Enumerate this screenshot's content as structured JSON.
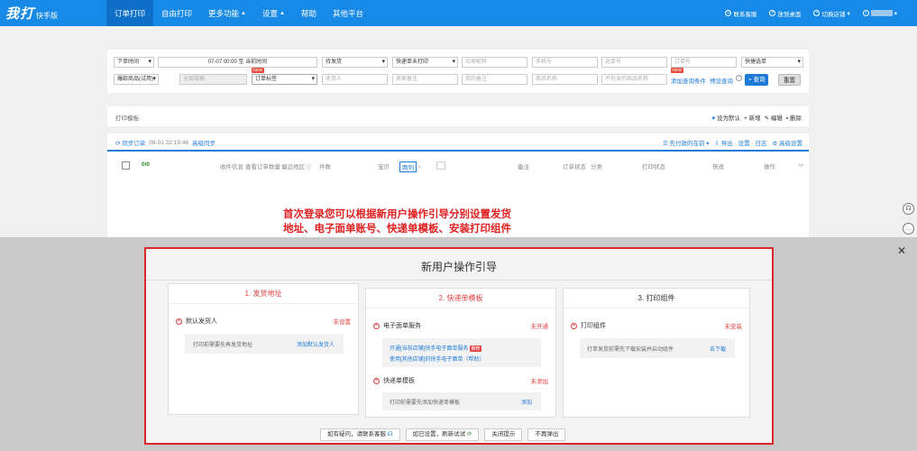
{
  "logo": {
    "main": "我打",
    "sub": "快手版"
  },
  "nav": [
    {
      "label": "订单打印",
      "active": true
    },
    {
      "label": "自由打印"
    },
    {
      "label": "更多功能",
      "caret": true
    },
    {
      "label": "设置",
      "caret": true
    },
    {
      "label": "帮助"
    },
    {
      "label": "其他平台"
    }
  ],
  "top_right": {
    "contact": "联系客服",
    "desktop": "放到桌面",
    "switch_shop": "切换店铺"
  },
  "search": {
    "order_time": "下单时间",
    "time_range": "07-07 00:00 至 当前时间",
    "status": "待发货",
    "express_print": "快递单未打印",
    "buyer_nick_ph": "买家昵称",
    "phone_ph": "手机号",
    "waybill_ph": "运单号",
    "order_no_ph": "订单号",
    "express_select": "快捷选单",
    "goods_select": "爆款商品(试用)",
    "all_spec_ph": "全部规格",
    "order_tag": "订单标签",
    "receiver_ph": "收货人",
    "seller_remark_ph": "卖家备注",
    "my_remark_ph": "我的备注",
    "goods_name_ph": "商品名称",
    "exclude_goods_ph": "不包含的商品名称",
    "add_condition": "添加查询条件",
    "preset_query": "预设查询",
    "query_btn": "查询",
    "reset_btn": "重置",
    "new_badge": "NEW"
  },
  "template": {
    "label": "打印模板:",
    "set_default": "设为默认",
    "add": "新增",
    "edit": "编辑",
    "delete": "删除"
  },
  "orders": {
    "sync": "同步订单",
    "sync_time": "09-01 22:19:46",
    "advanced_sync": "高级同步",
    "sort": "先付款的在前",
    "export": "导出 · 设置 · 日志",
    "advanced_settings": "高级设置",
    "count": "0/0",
    "headers": {
      "receiver_info": "收件信息",
      "view_count": "查看订单数量",
      "remote": "偏远地区",
      "pieces": "件数",
      "treasure": "宝贝",
      "wrap": "两列",
      "remark": "备注",
      "order_status": "订单状态",
      "split": "分类",
      "print_status": "打印状态",
      "express": "快递",
      "actions": "操作"
    }
  },
  "guide_text": [
    "首次登录您可以根据新用户操作引导分别设置发货",
    "地址、电子面单账号、快递单模板、安装打印组件"
  ],
  "modal": {
    "title": "新用户操作引导",
    "card1": {
      "title": "1. 发货地址",
      "item": "默认发货人",
      "status": "未设置",
      "desc": "打印前需要先再发货地址",
      "action": "添加默认发货人"
    },
    "card2": {
      "title": "2. 快递单模板",
      "item1": "电子面单服务",
      "status1": "未开通",
      "line1": "开通[当前店铺]快手电子面单服务",
      "hot": "推荐",
      "line2": "使用[其他店铺]的快手电子面单（帮助）",
      "item2": "快递单模板",
      "status2": "未添加",
      "desc2": "打印前需要先添加快递单模板",
      "action2": "添加"
    },
    "card3": {
      "title": "3. 打印组件",
      "item": "打印组件",
      "status": "未安装",
      "desc": "打单发货前需先下载安装并启动组件",
      "action": "去下载"
    },
    "buttons": {
      "help": "如有疑问，请联系客服",
      "refresh": "如已设置，刷新试试",
      "close": "关闭提示",
      "never": "不再弹出"
    }
  },
  "colors": {
    "topbar": "#1789e6",
    "accent": "#1d7ad6",
    "danger": "#e04141"
  }
}
